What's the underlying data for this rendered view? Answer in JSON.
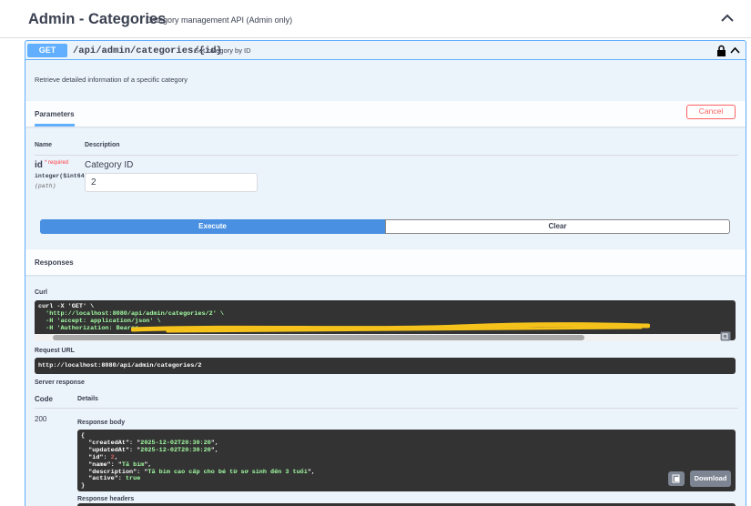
{
  "tag": {
    "title": "Admin - Categories",
    "description": "Category management API (Admin only)"
  },
  "operation": {
    "method": "GET",
    "path": "/api/admin/categories/{id}",
    "summary": "Get category by ID",
    "description": "Retrieve detailed information of a specific category"
  },
  "parameters": {
    "tab_label": "Parameters",
    "cancel_label": "Cancel",
    "col_name": "Name",
    "col_description": "Description",
    "items": [
      {
        "name": "id",
        "required": "* required",
        "type": "integer($int64)",
        "in": "(path)",
        "description": "Category ID",
        "value": "2"
      }
    ]
  },
  "actions": {
    "execute_label": "Execute",
    "clear_label": "Clear"
  },
  "responses": {
    "title": "Responses",
    "curl_label": "Curl",
    "curl_lines": [
      "curl -X 'GET' \\",
      "  'http://localhost:8080/api/admin/categories/2' \\",
      "  -H 'accept: application/json' \\",
      "  -H 'Authorization: Bearer "
    ],
    "request_url_label": "Request URL",
    "request_url": "http://localhost:8080/api/admin/categories/2",
    "server_response_label": "Server response",
    "code_col": "Code",
    "details_col": "Details",
    "code": "200",
    "body_label": "Response body",
    "body": {
      "createdAt": "2025-12-02T20:30:20",
      "updatedAt": "2025-12-02T20:30:20",
      "id": "2",
      "name": "Tã bỉm",
      "description": "Tã bỉm cao cấp cho bé từ sơ sinh đến 3 tuổi",
      "active": "true"
    },
    "download_label": "Download",
    "headers_label": "Response headers"
  },
  "colors": {
    "get_accent": "#61affe",
    "execute": "#4990e2",
    "cancel": "#ff6060",
    "code_bg": "#333333",
    "json_string": "#a2fca2",
    "json_number": "#d36363"
  },
  "icons": [
    "chevron-up-icon",
    "lock-icon",
    "copy-icon",
    "highlight-mark"
  ]
}
